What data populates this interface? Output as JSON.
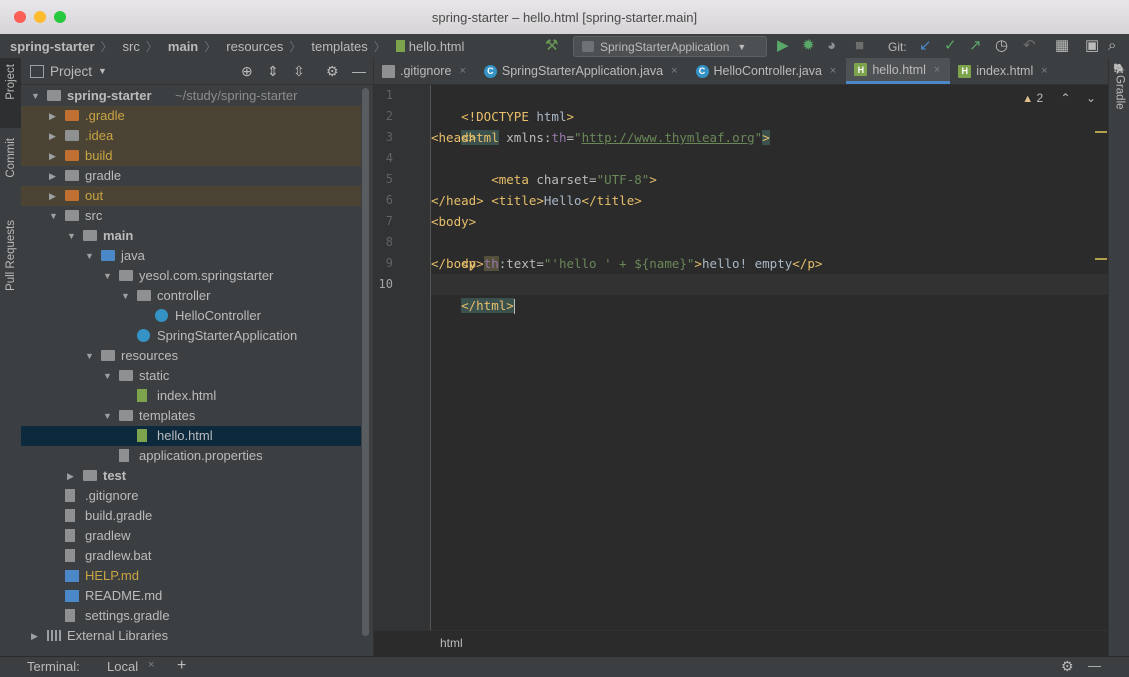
{
  "window": {
    "title": "spring-starter – hello.html [spring-starter.main]"
  },
  "navbar": {
    "crumbs": [
      "spring-starter",
      "src",
      "main",
      "resources",
      "templates",
      "hello.html"
    ],
    "run_config": "SpringStarterApplication",
    "git_label": "Git:"
  },
  "sidebar_left": {
    "project_tab": "Project",
    "commit_tab": "Commit",
    "pull_requests_tab": "Pull Requests"
  },
  "sidebar_right": {
    "gradle_tab": "Gradle"
  },
  "project": {
    "header": "Project",
    "tree": [
      {
        "label": "spring-starter",
        "suffix": "~/study/spring-starter",
        "depth": 0,
        "arrow": "down",
        "icon": "module-folder-icon",
        "bold": true
      },
      {
        "label": ".gradle",
        "depth": 1,
        "arrow": "right",
        "icon": "folder-icon",
        "color": "orange",
        "ignored": true
      },
      {
        "label": ".idea",
        "depth": 1,
        "arrow": "right",
        "icon": "folder-icon",
        "color": "gray",
        "ignored": true
      },
      {
        "label": "build",
        "depth": 1,
        "arrow": "right",
        "icon": "folder-icon",
        "color": "orange",
        "ignored": true
      },
      {
        "label": "gradle",
        "depth": 1,
        "arrow": "right",
        "icon": "folder-icon",
        "color": "gray"
      },
      {
        "label": "out",
        "depth": 1,
        "arrow": "right",
        "icon": "folder-icon",
        "color": "orange",
        "ignored": true
      },
      {
        "label": "src",
        "depth": 1,
        "arrow": "down",
        "icon": "folder-icon",
        "color": "gray"
      },
      {
        "label": "main",
        "depth": 2,
        "arrow": "down",
        "icon": "folder-icon",
        "color": "gray",
        "bold": true
      },
      {
        "label": "java",
        "depth": 3,
        "arrow": "down",
        "icon": "source-folder-icon",
        "color": "blue"
      },
      {
        "label": "yesol.com.springstarter",
        "depth": 4,
        "arrow": "down",
        "icon": "package-icon",
        "color": "gray"
      },
      {
        "label": "controller",
        "depth": 5,
        "arrow": "down",
        "icon": "package-icon",
        "color": "gray"
      },
      {
        "label": "HelloController",
        "depth": 6,
        "arrow": "",
        "icon": "class-icon"
      },
      {
        "label": "SpringStarterApplication",
        "depth": 5,
        "arrow": "",
        "icon": "spring-class-icon"
      },
      {
        "label": "resources",
        "depth": 3,
        "arrow": "down",
        "icon": "resources-folder-icon",
        "color": "gray"
      },
      {
        "label": "static",
        "depth": 4,
        "arrow": "down",
        "icon": "folder-icon",
        "color": "gray"
      },
      {
        "label": "index.html",
        "depth": 5,
        "arrow": "",
        "icon": "html-file-icon"
      },
      {
        "label": "templates",
        "depth": 4,
        "arrow": "down",
        "icon": "folder-icon",
        "color": "gray"
      },
      {
        "label": "hello.html",
        "depth": 5,
        "arrow": "",
        "icon": "html-file-icon",
        "selected": true
      },
      {
        "label": "application.properties",
        "depth": 4,
        "arrow": "",
        "icon": "properties-file-icon"
      },
      {
        "label": "test",
        "depth": 2,
        "arrow": "right",
        "icon": "folder-icon",
        "color": "gray",
        "bold": true
      },
      {
        "label": ".gitignore",
        "depth": 1,
        "arrow": "",
        "icon": "gitignore-file-icon"
      },
      {
        "label": "build.gradle",
        "depth": 1,
        "arrow": "",
        "icon": "gradle-file-icon"
      },
      {
        "label": "gradlew",
        "depth": 1,
        "arrow": "",
        "icon": "text-file-icon"
      },
      {
        "label": "gradlew.bat",
        "depth": 1,
        "arrow": "",
        "icon": "text-file-icon"
      },
      {
        "label": "HELP.md",
        "depth": 1,
        "arrow": "",
        "icon": "markdown-file-icon",
        "yellow": true
      },
      {
        "label": "README.md",
        "depth": 1,
        "arrow": "",
        "icon": "markdown-file-icon"
      },
      {
        "label": "settings.gradle",
        "depth": 1,
        "arrow": "",
        "icon": "gradle-file-icon"
      },
      {
        "label": "External Libraries",
        "depth": 0,
        "arrow": "right",
        "icon": "libraries-icon"
      }
    ]
  },
  "tabs": [
    {
      "label": ".gitignore",
      "icon": "gitignore-file-icon"
    },
    {
      "label": "SpringStarterApplication.java",
      "icon": "spring-class-icon"
    },
    {
      "label": "HelloController.java",
      "icon": "class-icon"
    },
    {
      "label": "hello.html",
      "icon": "html-file-icon",
      "active": true
    },
    {
      "label": "index.html",
      "icon": "html-file-icon"
    }
  ],
  "editor": {
    "warnings_count": "2",
    "line_numbers": [
      "1",
      "2",
      "3",
      "4",
      "5",
      "6",
      "7",
      "8",
      "9",
      "10"
    ],
    "current_line": 10,
    "breadcrumb": "html"
  },
  "bottom": {
    "terminal_label": "Terminal:",
    "local_tab": "Local",
    "add": "+"
  },
  "colors": {
    "ignored_bg": "#4b4434",
    "selected_bg": "#0d293e",
    "accent": "#4a88c7",
    "orange_folder": "#c07031"
  }
}
